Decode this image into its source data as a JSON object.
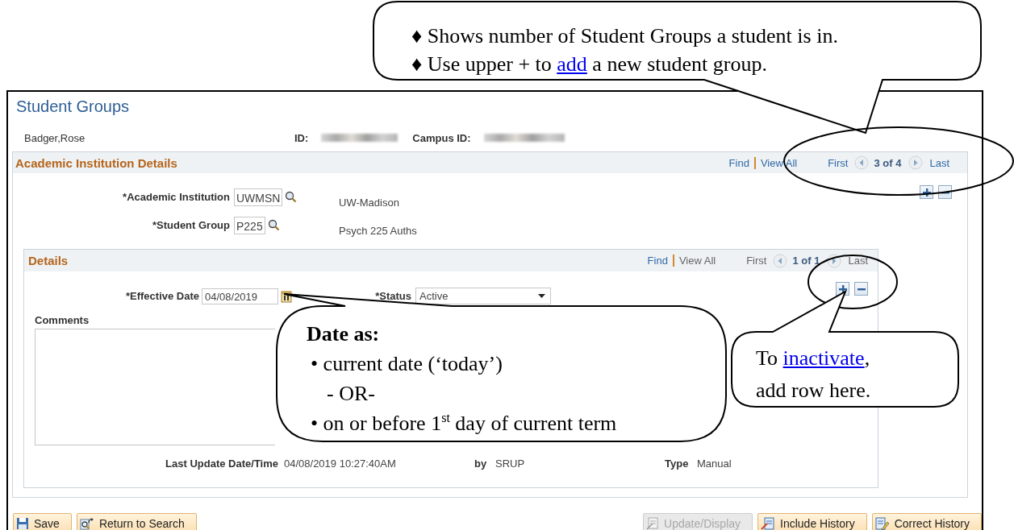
{
  "window": {
    "title": "Student Groups"
  },
  "header": {
    "name": "Badger,Rose",
    "id_label": "ID:",
    "campus_id_label": "Campus ID:"
  },
  "institution_section": {
    "title": "Academic Institution Details",
    "pager": {
      "find": {
        "text": "Find",
        "disabled": false
      },
      "view_all": {
        "text": "View All",
        "disabled": false
      },
      "first": {
        "text": "First",
        "disabled": false
      },
      "count": "3 of 4",
      "last": {
        "text": "Last",
        "disabled": false
      }
    },
    "fields": [
      {
        "label": "*Academic Institution",
        "value": "UWMSN",
        "description": "UW-Madison"
      },
      {
        "label": "*Student Group",
        "value": "P225",
        "description": "Psych 225 Auths"
      }
    ]
  },
  "details_section": {
    "title": "Details",
    "pager": {
      "find": {
        "text": "Find",
        "disabled": false
      },
      "view_all": {
        "text": "View All",
        "disabled": true
      },
      "first": {
        "text": "First",
        "disabled": true
      },
      "count": "1 of 1",
      "last": {
        "text": "Last",
        "disabled": true
      }
    },
    "effective_date": {
      "label": "*Effective Date",
      "value": "04/08/2019"
    },
    "status": {
      "label": "*Status",
      "value": "Active"
    },
    "comments": {
      "label": "Comments"
    },
    "last_update": {
      "label": "Last Update Date/Time",
      "value": "04/08/2019 10:27:40AM"
    },
    "updated_by": {
      "label": "by",
      "value": "SRUP"
    },
    "type": {
      "label": "Type",
      "value": "Manual"
    }
  },
  "buttons_left": [
    {
      "label": "Save",
      "kind": "save",
      "disabled": false
    },
    {
      "label": "Return to Search",
      "kind": "return",
      "disabled": false
    }
  ],
  "buttons_right": [
    {
      "label": "Update/Display",
      "kind": "update",
      "disabled": true
    },
    {
      "label": "Include History",
      "kind": "include",
      "disabled": false
    },
    {
      "label": "Correct History",
      "kind": "correct",
      "disabled": false
    }
  ],
  "callouts": [
    {
      "lines": [
        {
          "kind": "plain",
          "text": "♦ Shows number of Student Groups a student is in."
        },
        {
          "kind": "plain",
          "text": "♦ Use upper + to ",
          "link": "add",
          "after": " a new student group."
        }
      ]
    },
    {
      "lines": [
        {
          "kind": "title",
          "text": "Date as:"
        },
        {
          "kind": "bullet",
          "text": "• current date (‘today’)"
        },
        {
          "kind": "sub",
          "text": "- OR-"
        },
        {
          "kind": "bullet",
          "text": "• on or before 1$^{st}$ day of current term"
        }
      ]
    },
    {
      "lines": [
        {
          "kind": "plain",
          "text": "To ",
          "link": "inactivate",
          "after": ","
        },
        {
          "kind": "plain",
          "text": "add row here."
        }
      ]
    }
  ]
}
